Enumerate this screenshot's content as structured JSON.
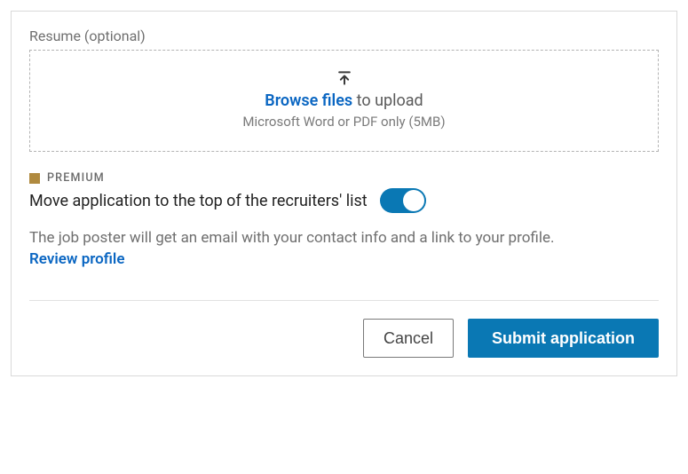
{
  "resume": {
    "section_label": "Resume (optional)",
    "browse_text": "Browse files",
    "upload_suffix": " to upload",
    "hint": "Microsoft Word or PDF only (5MB)"
  },
  "premium": {
    "badge_text": "PREMIUM",
    "toggle_label": "Move application to the top of the recruiters' list",
    "toggle_on": true
  },
  "info": {
    "text": "The job poster will get an email with your contact info and a link to your profile.",
    "review_link": "Review profile"
  },
  "footer": {
    "cancel": "Cancel",
    "submit": "Submit application"
  }
}
